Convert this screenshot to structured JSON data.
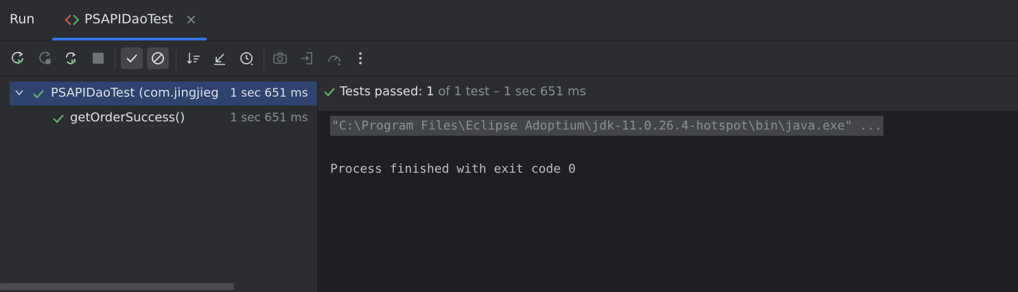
{
  "tabbar": {
    "run_label": "Run",
    "tab_label": "PSAPIDaoTest",
    "close_glyph": "×",
    "accent": "#3574f0"
  },
  "toolbar": {
    "icons": [
      "rerun-icon",
      "rerun-failed-icon",
      "rerun-automatically-icon",
      "stop-icon",
      "show-passed-icon",
      "show-ignored-icon",
      "sort-icon",
      "collapse-icon",
      "history-icon",
      "snapshot-icon",
      "import-icon",
      "coverage-icon",
      "more-icon"
    ]
  },
  "tree": {
    "root": {
      "label": "PSAPIDaoTest (com.jingjieg",
      "time": "1 sec 651 ms"
    },
    "child": {
      "label": "getOrderSuccess()",
      "time": "1 sec 651 ms"
    }
  },
  "status": {
    "passed_label": "Tests passed: 1",
    "detail": " of 1 test – 1 sec 651 ms",
    "color_pass": "#5fb865"
  },
  "console": {
    "command": "\"C:\\Program Files\\Eclipse Adoptium\\jdk-11.0.26.4-hotspot\\bin\\java.exe\" ...",
    "exit_message": "Process finished with exit code 0"
  }
}
